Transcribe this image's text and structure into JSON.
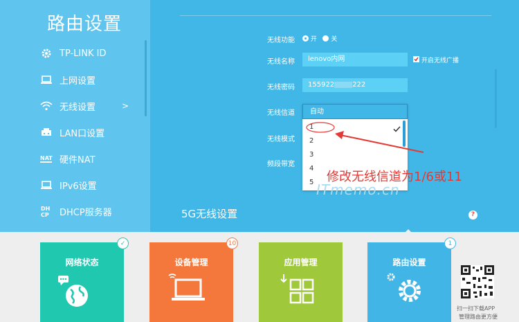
{
  "sidebar": {
    "title": "路由设置",
    "items": [
      {
        "label": "TP-LINK ID",
        "icon": "gear-icon"
      },
      {
        "label": "上网设置",
        "icon": "monitor-icon"
      },
      {
        "label": "无线设置",
        "icon": "wifi-icon",
        "arrow": ">"
      },
      {
        "label": "LAN口设置",
        "icon": "lan-icon"
      },
      {
        "label": "硬件NAT",
        "icon": "nat-icon"
      },
      {
        "label": "IPv6设置",
        "icon": "monitor-icon"
      },
      {
        "label": "DHCP服务器",
        "icon": "dhcp-icon"
      }
    ]
  },
  "wireless": {
    "func_label": "无线功能",
    "on_label": "开",
    "off_label": "关",
    "name_label": "无线名称",
    "name_value": "lenovo内网",
    "broadcast_label": "开启无线广播",
    "pwd_label": "无线密码",
    "pwd_value": "155922",
    "pwd_suffix": "222",
    "channel_label": "无线信道",
    "mode_label": "无线模式",
    "bandwidth_label": "频段带宽",
    "channel_selected": "自动",
    "channel_options": [
      "1",
      "2",
      "3",
      "4",
      "5"
    ]
  },
  "section_5g": "5G无线设置",
  "help_mark": "?",
  "annotation": "修改无线信道为1/6或11",
  "watermark": "ITmemo.cn",
  "cards": [
    {
      "label": "网络状态",
      "color": "#21c8b0",
      "badge": "✓",
      "badge_color": "#21c8b0"
    },
    {
      "label": "设备管理",
      "color": "#f4773c",
      "badge": "10",
      "badge_color": "#f4773c"
    },
    {
      "label": "应用管理",
      "color": "#9fc93b",
      "badge": "",
      "badge_color": ""
    },
    {
      "label": "路由设置",
      "color": "#41b6e6",
      "badge": "1",
      "badge_color": "#41b6e6"
    }
  ],
  "qr": {
    "line1": "扫一扫下载APP",
    "line2": "管理路由更方便"
  }
}
